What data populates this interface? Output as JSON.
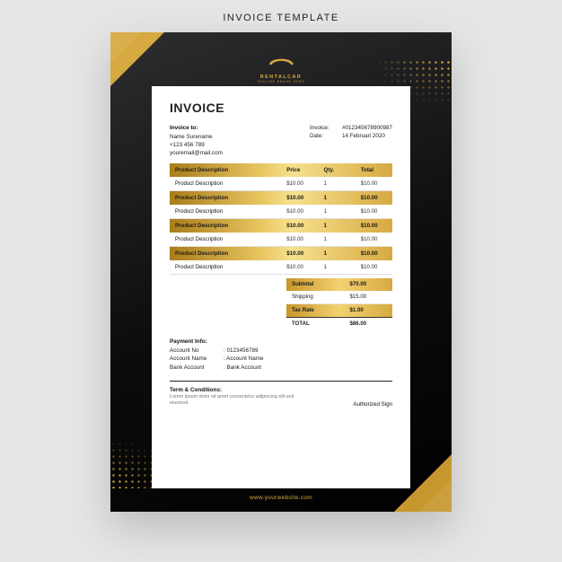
{
  "caption": "INVOICE TEMPLATE",
  "brand": {
    "name": "RENTALCAR",
    "tagline": "TAGLINE BRAND HERE"
  },
  "title": "INVOICE",
  "invoice_to": {
    "label": "Invoice to:",
    "name": "Name Surename",
    "phone": "+123 456 789",
    "email": "youremail@mail.com"
  },
  "meta": {
    "invoice_label": "Invoice:",
    "invoice_number": "#012345678900987",
    "date_label": "Date:",
    "date_value": "14 Februari 2020"
  },
  "columns": {
    "desc": "Product Description",
    "price": "Price",
    "qty": "Qty.",
    "total": "Total"
  },
  "items": [
    {
      "desc": "Product Description",
      "price": "$10.00",
      "qty": "1",
      "total": "$10.00"
    },
    {
      "desc": "Product Description",
      "price": "$10.00",
      "qty": "1",
      "total": "$10.00"
    },
    {
      "desc": "Product Description",
      "price": "$10.00",
      "qty": "1",
      "total": "$10.00"
    },
    {
      "desc": "Product Description",
      "price": "$10.00",
      "qty": "1",
      "total": "$10.00"
    },
    {
      "desc": "Product Description",
      "price": "$10.00",
      "qty": "1",
      "total": "$10.00"
    },
    {
      "desc": "Product Description",
      "price": "$10.00",
      "qty": "1",
      "total": "$10.00"
    },
    {
      "desc": "Product Description",
      "price": "$10.00",
      "qty": "1",
      "total": "$10.00"
    }
  ],
  "summary": {
    "subtotal_label": "Subtotal",
    "subtotal_value": "$70.00",
    "shipping_label": "Shipping",
    "shipping_value": "$15.00",
    "tax_label": "Tax Rate",
    "tax_value": "$1.00",
    "total_label": "TOTAL",
    "total_value": "$86.00"
  },
  "payment": {
    "label": "Payment Info:",
    "account_label": "Account No",
    "account_value": ": 0123456789",
    "name_label": "Account Name",
    "name_value": ": Account Name",
    "bank_label": "Bank Account",
    "bank_value": ": Bank Account"
  },
  "terms": {
    "label": "Term & Conditions:",
    "text": "Lorem ipsum dolor sit amet consectetur adipiscing elit sed eiusmod."
  },
  "authorized": "Authorized Sign",
  "website": "www.yourwebsite.com"
}
